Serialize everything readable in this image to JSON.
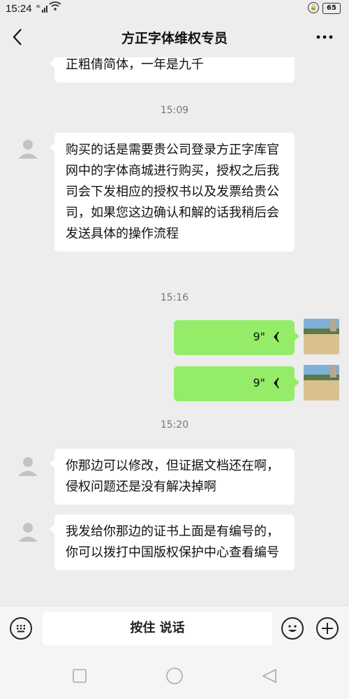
{
  "status_bar": {
    "time": "15:24",
    "network": "4G",
    "battery": "65"
  },
  "header": {
    "title": "方正字体维权专员",
    "back_icon": "chevron-left-icon",
    "more_icon": "more-dots-icon"
  },
  "messages": [
    {
      "type": "text",
      "direction": "in",
      "text": "正粗倩简体，一年是九千"
    },
    {
      "type": "time",
      "text": "15:09"
    },
    {
      "type": "text",
      "direction": "in",
      "text": "购买的话是需要贵公司登录方正字库官网中的字体商城进行购买，授权之后我司会下发相应的授权书以及发票给贵公司，如果您这边确认和解的话我稍后会发送具体的操作流程"
    },
    {
      "type": "time",
      "text": "15:16"
    },
    {
      "type": "voice",
      "direction": "out",
      "duration": "9\""
    },
    {
      "type": "voice",
      "direction": "out",
      "duration": "9\""
    },
    {
      "type": "time",
      "text": "15:20"
    },
    {
      "type": "text",
      "direction": "in",
      "text": "你那边可以修改，但证据文档还在啊，侵权问题还是没有解决掉啊"
    },
    {
      "type": "text",
      "direction": "in",
      "text": "我发给你那边的证书上面是有编号的，你可以拨打中国版权保护中心查看编号"
    }
  ],
  "input_bar": {
    "hold_to_talk": "按住 说话",
    "keyboard_icon": "keyboard-icon",
    "emoji_icon": "emoji-icon",
    "plus_icon": "plus-icon"
  },
  "nav": {
    "recent_icon": "square-icon",
    "home_icon": "circle-icon",
    "back_icon": "triangle-back-icon"
  },
  "colors": {
    "background": "#ededed",
    "outgoing_bubble": "#95ec69",
    "incoming_bubble": "#ffffff"
  }
}
